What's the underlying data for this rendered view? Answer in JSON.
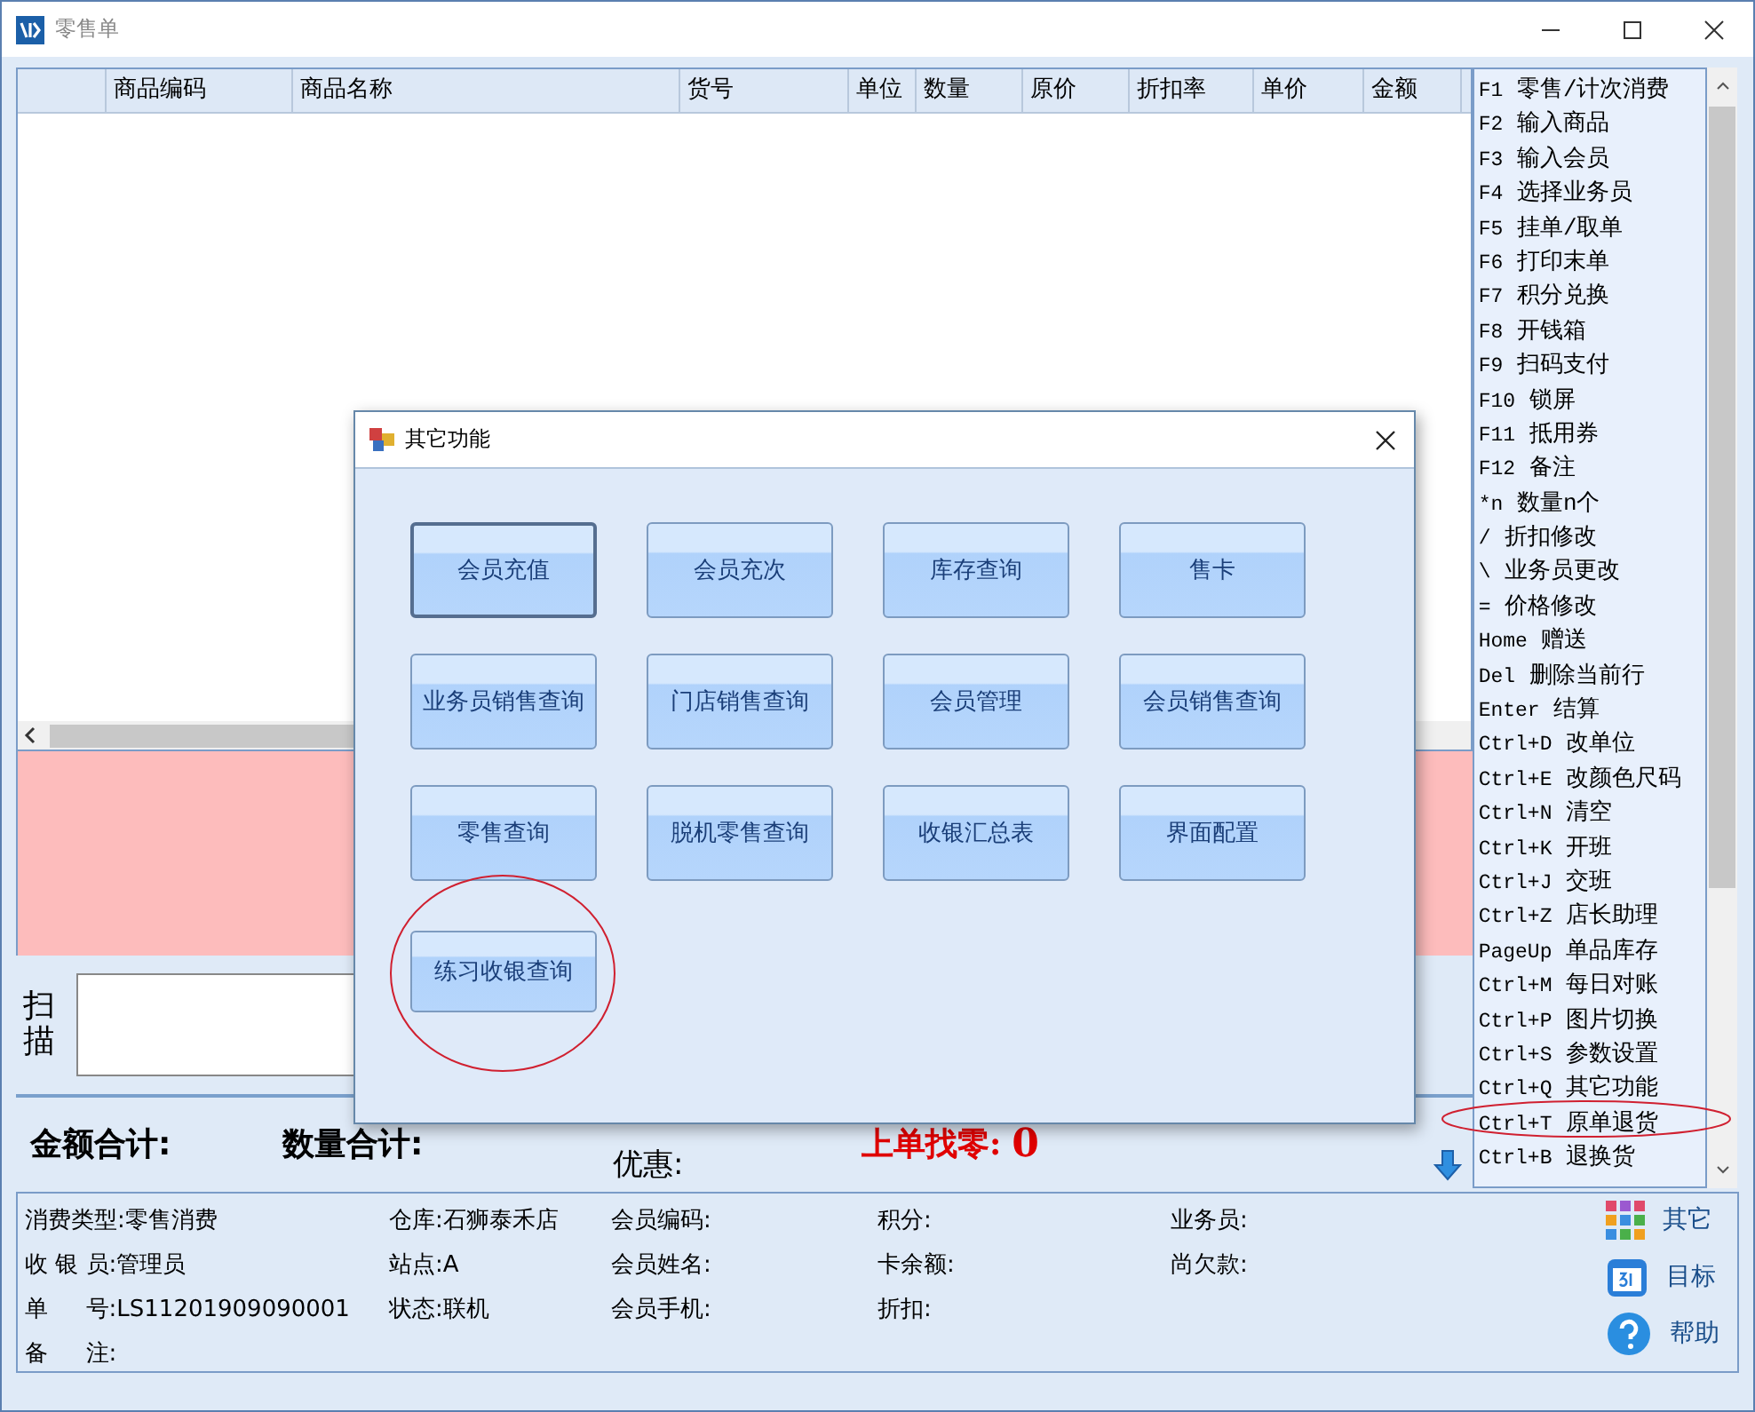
{
  "window": {
    "title": "零售单"
  },
  "table": {
    "columns": [
      "商品编码",
      "商品名称",
      "货号",
      "单位",
      "数量",
      "原价",
      "折扣率",
      "单价",
      "金额"
    ]
  },
  "shortcuts": [
    {
      "key": "F1",
      "label": "零售/计次消费"
    },
    {
      "key": "F2",
      "label": "输入商品"
    },
    {
      "key": "F3",
      "label": "输入会员"
    },
    {
      "key": "F4",
      "label": "选择业务员"
    },
    {
      "key": "F5",
      "label": "挂单/取单"
    },
    {
      "key": "F6",
      "label": "打印末单"
    },
    {
      "key": "F7",
      "label": "积分兑换"
    },
    {
      "key": "F8",
      "label": "开钱箱"
    },
    {
      "key": "F9",
      "label": "扫码支付"
    },
    {
      "key": "F10",
      "label": "锁屏"
    },
    {
      "key": "F11",
      "label": "抵用券"
    },
    {
      "key": "F12",
      "label": "备注"
    },
    {
      "key": "*n",
      "label": "数量n个"
    },
    {
      "key": "/",
      "label": "折扣修改"
    },
    {
      "key": "\\",
      "label": "业务员更改"
    },
    {
      "key": "=",
      "label": "价格修改"
    },
    {
      "key": "Home",
      "label": "赠送"
    },
    {
      "key": "Del",
      "label": "删除当前行"
    },
    {
      "key": "Enter",
      "label": "结算"
    },
    {
      "key": "Ctrl+D",
      "label": "改单位"
    },
    {
      "key": "Ctrl+E",
      "label": "改颜色尺码"
    },
    {
      "key": "Ctrl+N",
      "label": "清空"
    },
    {
      "key": "Ctrl+K",
      "label": "开班"
    },
    {
      "key": "Ctrl+J",
      "label": "交班"
    },
    {
      "key": "Ctrl+Z",
      "label": "店长助理"
    },
    {
      "key": "PageUp",
      "label": "单品库存"
    },
    {
      "key": "Ctrl+M",
      "label": "每日对账"
    },
    {
      "key": "Ctrl+P",
      "label": "图片切换"
    },
    {
      "key": "Ctrl+S",
      "label": "参数设置"
    },
    {
      "key": "Ctrl+Q",
      "label": "其它功能"
    },
    {
      "key": "Ctrl+T",
      "label": "原单退货"
    },
    {
      "key": "Ctrl+B",
      "label": "退换货"
    }
  ],
  "scan": {
    "label": "扫描"
  },
  "totals": {
    "amount_label": "金额合计:",
    "quantity_label": "数量合计:",
    "discount_label": "优惠:",
    "change_label": "上单找零:",
    "change_value": "0"
  },
  "info": [
    [
      {
        "label": "消费类型:",
        "value": "零售消费"
      },
      {
        "label": "仓库:",
        "value": "石狮泰禾店"
      },
      {
        "label": "会员编码:"
      },
      {
        "label": "积分:"
      },
      {
        "label": "业务员:"
      }
    ],
    [
      {
        "label": "收 银 员:",
        "value": "管理员"
      },
      {
        "label": "站点:",
        "value": "A"
      },
      {
        "label": "会员姓名:"
      },
      {
        "label": "卡余额:"
      },
      {
        "label": "尚欠款:"
      }
    ],
    [
      {
        "label": "单　  号:",
        "value": "LS11201909090001"
      },
      {
        "label": "状态:",
        "value": "联机"
      },
      {
        "label": "会员手机:"
      },
      {
        "label": "折扣:"
      }
    ],
    [
      {
        "label": "备　  注:"
      }
    ]
  ],
  "side_buttons": [
    {
      "kind": "grid",
      "label": "其它"
    },
    {
      "kind": "calendar",
      "label": "目标"
    },
    {
      "kind": "help",
      "label": "帮助"
    }
  ],
  "dialog": {
    "title": "其它功能",
    "buttons": [
      {
        "label": "会员充值",
        "selected": true
      },
      {
        "label": "会员充次",
        "selected": false
      },
      {
        "label": "库存查询",
        "selected": false
      },
      {
        "label": "售卡",
        "selected": false
      },
      {
        "label": "业务员销售查询",
        "selected": false
      },
      {
        "label": "门店销售查询",
        "selected": false
      },
      {
        "label": "会员管理",
        "selected": false
      },
      {
        "label": "会员销售查询",
        "selected": false
      },
      {
        "label": "零售查询",
        "selected": false
      },
      {
        "label": "脱机零售查询",
        "selected": false
      },
      {
        "label": "收银汇总表",
        "selected": false
      },
      {
        "label": "界面配置",
        "selected": false
      },
      {
        "label": "练习收银查询",
        "selected": false
      }
    ]
  }
}
